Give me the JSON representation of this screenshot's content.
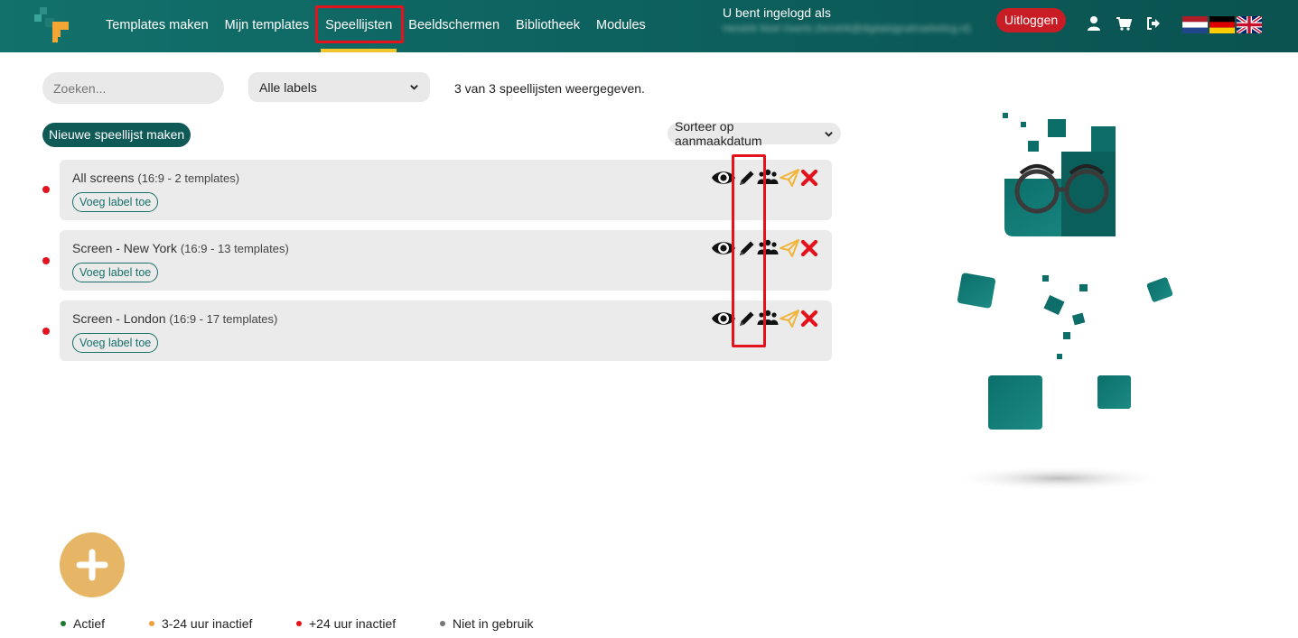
{
  "nav": {
    "items": [
      {
        "label": "Templates maken"
      },
      {
        "label": "Mijn templates"
      },
      {
        "label": "Speellijsten"
      },
      {
        "label": "Beeldschermen"
      },
      {
        "label": "Bibliotheek"
      },
      {
        "label": "Modules"
      }
    ],
    "active": "Speellijsten"
  },
  "account": {
    "logged_in_label": "U bent ingelogd als",
    "email_blurred": "Hendrik Noel Geerts (hendrik@digitalsignalmarketing.nl)",
    "logout_label": "Uitloggen",
    "icons": [
      "user-icon",
      "cart-icon",
      "sign-out-icon"
    ]
  },
  "languages": [
    "nl",
    "de",
    "en"
  ],
  "filters": {
    "search_placeholder": "Zoeken...",
    "labels_value": "Alle labels",
    "count_text": "3 van 3 speellijsten weergegeven.",
    "new_playlist_label": "Nieuwe speellijst maken",
    "sort_value": "Sorteer op aanmaakdatum"
  },
  "playlists": [
    {
      "name": "All screens",
      "meta": "(16:9 - 2 templates)",
      "label_button": "Voeg label toe",
      "status": "+24 uur inactief"
    },
    {
      "name": "Screen -  New York",
      "meta": "(16:9 - 13 templates)",
      "label_button": "Voeg label toe",
      "status": "+24 uur inactief"
    },
    {
      "name": "Screen -  London",
      "meta": "(16:9 - 17 templates)",
      "label_button": "Voeg label toe",
      "status": "+24 uur inactief"
    }
  ],
  "row_actions": [
    "eye-icon",
    "pencil-icon",
    "users-icon",
    "send-icon",
    "delete-icon"
  ],
  "legend": [
    {
      "label": "Actief",
      "color": "#1a7a2e"
    },
    {
      "label": "3-24 uur inactief",
      "color": "#f0a33a"
    },
    {
      "label": "+24 uur inactief",
      "color": "#e3121c"
    },
    {
      "label": "Niet in gebruik",
      "color": "#777777"
    }
  ],
  "colors": {
    "topbar": "#0f6a66",
    "active_underline": "#f2c52c",
    "highlight": "#e3121c",
    "logout": "#c81d24",
    "primary_button": "#0f5a57",
    "add_button": "#e7b566",
    "edit_action": "#111111",
    "send_action": "#f1b53a",
    "delete_action": "#e3121c"
  }
}
